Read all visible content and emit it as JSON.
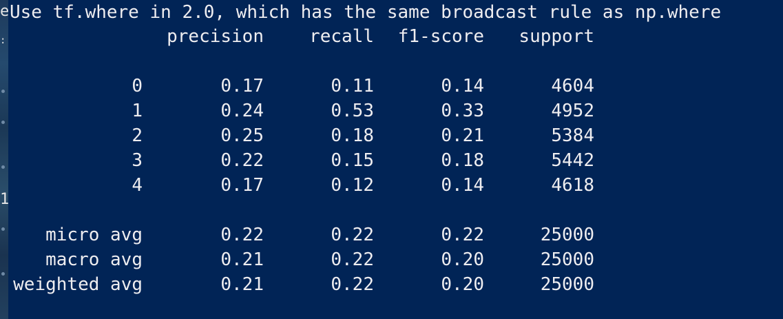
{
  "left_edge": {
    "fragment_top": "e",
    "fragment_mid": ":",
    "fragment_low": "1"
  },
  "console": {
    "command_line": "Use tf.where in 2.0, which has the same broadcast rule as np.where",
    "headers": [
      "precision",
      "recall",
      "f1-score",
      "support"
    ],
    "class_rows": [
      {
        "label": "0",
        "precision": "0.17",
        "recall": "0.11",
        "f1": "0.14",
        "support": "4604"
      },
      {
        "label": "1",
        "precision": "0.24",
        "recall": "0.53",
        "f1": "0.33",
        "support": "4952"
      },
      {
        "label": "2",
        "precision": "0.25",
        "recall": "0.18",
        "f1": "0.21",
        "support": "5384"
      },
      {
        "label": "3",
        "precision": "0.22",
        "recall": "0.15",
        "f1": "0.18",
        "support": "5442"
      },
      {
        "label": "4",
        "precision": "0.17",
        "recall": "0.12",
        "f1": "0.14",
        "support": "4618"
      }
    ],
    "avg_rows": [
      {
        "label": "micro avg",
        "precision": "0.22",
        "recall": "0.22",
        "f1": "0.22",
        "support": "25000"
      },
      {
        "label": "macro avg",
        "precision": "0.21",
        "recall": "0.22",
        "f1": "0.20",
        "support": "25000"
      },
      {
        "label": "weighted avg",
        "precision": "0.21",
        "recall": "0.22",
        "f1": "0.20",
        "support": "25000"
      }
    ]
  },
  "colors": {
    "console_background": "#012456",
    "console_text": "#eeedf0"
  }
}
